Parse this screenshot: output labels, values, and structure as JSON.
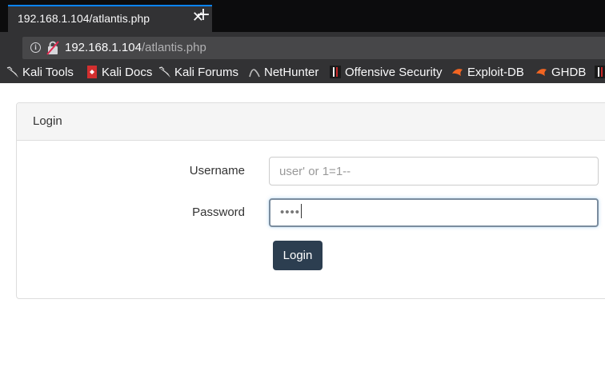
{
  "browser": {
    "tab_title": "192.168.1.104/atlantis.php",
    "tab_close": "✕",
    "new_tab": "+",
    "url_host": "192.168.1.104",
    "url_path": "/atlantis.php"
  },
  "bookmarks": [
    {
      "label": "Kali Tools",
      "icon": "kali-dragon-icon"
    },
    {
      "label": "Kali Docs",
      "icon": "kali-docs-icon"
    },
    {
      "label": "Kali Forums",
      "icon": "kali-dragon-icon"
    },
    {
      "label": "NetHunter",
      "icon": "nethunter-icon"
    },
    {
      "label": "Offensive Security",
      "icon": "offsec-icon"
    },
    {
      "label": "Exploit-DB",
      "icon": "exploit-db-icon"
    },
    {
      "label": "GHDB",
      "icon": "ghdb-icon"
    }
  ],
  "page": {
    "panel_title": "Login",
    "username_label": "Username",
    "username_value": "user' or 1=1--",
    "password_label": "Password",
    "password_value": "••••",
    "login_button": "Login"
  },
  "colors": {
    "accent_tab": "#0a84ff",
    "button_bg": "#2c3e50"
  }
}
